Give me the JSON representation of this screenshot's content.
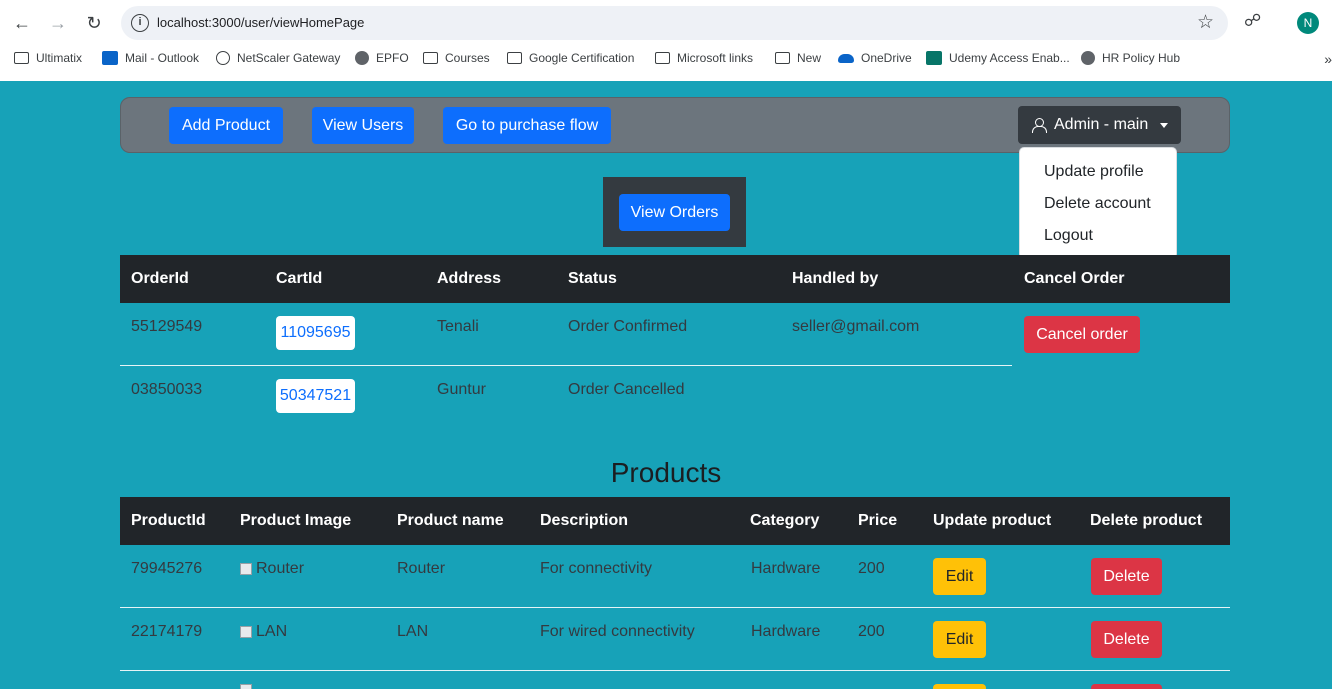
{
  "browser": {
    "url": "localhost:3000/user/viewHomePage",
    "avatar_letter": "N",
    "bookmarks": [
      {
        "label": "Ultimatix",
        "icon": "folder-icon"
      },
      {
        "label": "Mail - Outlook",
        "icon": "outlook-icon"
      },
      {
        "label": "NetScaler Gateway",
        "icon": "lock-icon"
      },
      {
        "label": "EPFO",
        "icon": "globe-icon"
      },
      {
        "label": "Courses",
        "icon": "folder-icon"
      },
      {
        "label": "Google Certification",
        "icon": "folder-icon"
      },
      {
        "label": "Microsoft links",
        "icon": "folder-icon"
      },
      {
        "label": "New",
        "icon": "folder-icon"
      },
      {
        "label": "OneDrive",
        "icon": "onedrive-icon"
      },
      {
        "label": "Udemy Access Enab...",
        "icon": "forms-icon"
      },
      {
        "label": "HR Policy Hub",
        "icon": "globe-icon"
      }
    ],
    "more": "»"
  },
  "navbar": {
    "add_product": "Add Product",
    "view_users": "View Users",
    "purchase_flow": "Go to purchase flow",
    "user_menu": "Admin - main",
    "menu_items": [
      "Update profile",
      "Delete account",
      "Logout"
    ]
  },
  "orders": {
    "button": "View Orders",
    "headers": [
      "OrderId",
      "CartId",
      "Address",
      "Status",
      "Handled by",
      "Cancel Order"
    ],
    "rows": [
      {
        "order_id": "55129549",
        "cart_id": "11095695",
        "address": "Tenali",
        "status": "Order Confirmed",
        "handled_by": "seller@gmail.com",
        "cancel": "Cancel order"
      },
      {
        "order_id": "03850033",
        "cart_id": "50347521",
        "address": "Guntur",
        "status": "Order Cancelled",
        "handled_by": "",
        "cancel": ""
      }
    ]
  },
  "products": {
    "title": "Products",
    "headers": [
      "ProductId",
      "Product Image",
      "Product name",
      "Description",
      "Category",
      "Price",
      "Update product",
      "Delete product"
    ],
    "edit_label": "Edit",
    "delete_label": "Delete",
    "rows": [
      {
        "id": "79945276",
        "image_alt": "Router",
        "name": "Router",
        "description": "For connectivity",
        "category": "Hardware",
        "price": "200"
      },
      {
        "id": "22174179",
        "image_alt": "LAN",
        "name": "LAN",
        "description": "For wired connectivity",
        "category": "Hardware",
        "price": "200"
      }
    ]
  },
  "colors": {
    "page_bg": "#17a2b8",
    "primary": "#0d6efd",
    "danger": "#dc3545",
    "warning": "#ffc107",
    "dark": "#212529"
  }
}
